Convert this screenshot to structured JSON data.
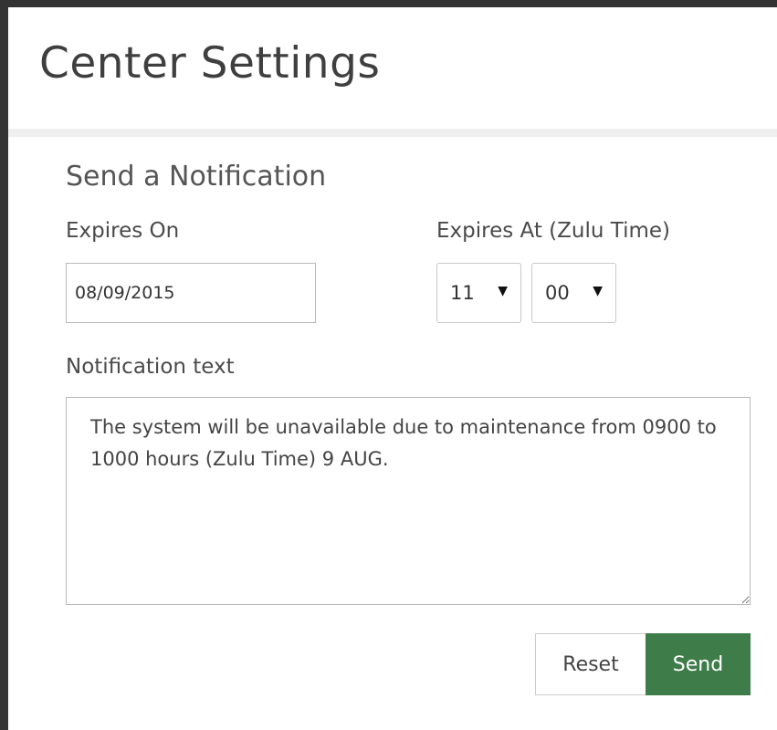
{
  "header": {
    "title": "Center Settings"
  },
  "notification_form": {
    "section_title": "Send a Notification",
    "expires_on": {
      "label": "Expires On",
      "value": "08/09/2015"
    },
    "expires_at": {
      "label": "Expires At (Zulu Time)",
      "hour": "11",
      "minute": "00",
      "arrow_icon": "caret-down-icon"
    },
    "notification_text": {
      "label": "Notification text",
      "value": "The system will be unavailable due to maintenance from 0900 to 1000 hours (Zulu Time) 9 AUG."
    },
    "buttons": {
      "reset_label": "Reset",
      "send_label": "Send"
    }
  },
  "colors": {
    "send_button": "#3e7c4a",
    "window_border": "#333333"
  }
}
